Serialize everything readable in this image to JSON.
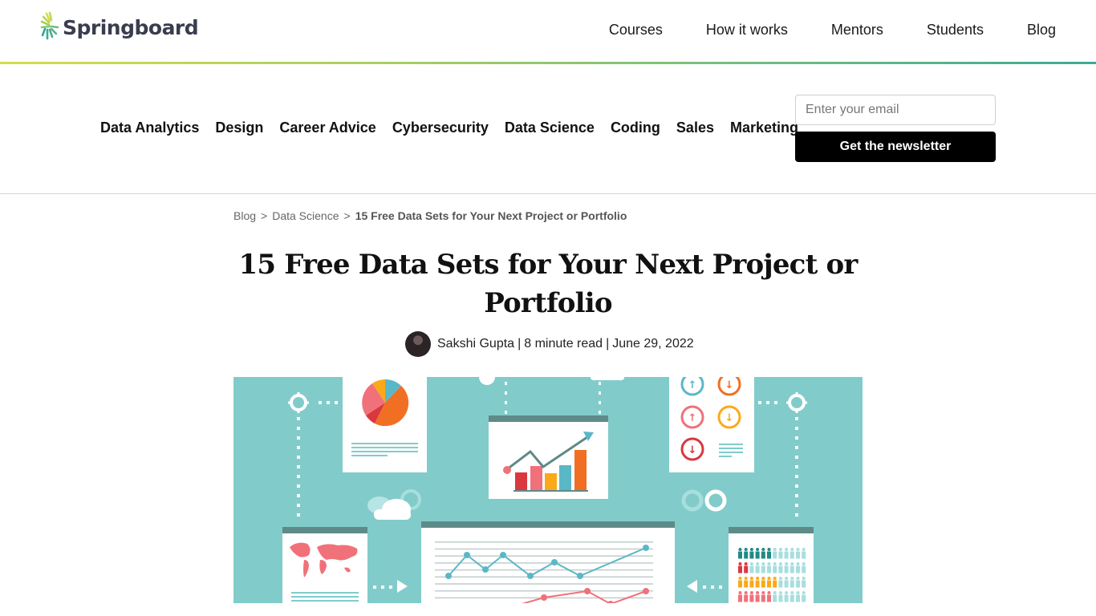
{
  "brand": {
    "name": "Springboard",
    "colors": {
      "text": "#3a3d4f",
      "accent_start": "#d3dd4a",
      "accent_end": "#3bab96"
    }
  },
  "topnav": {
    "items": [
      {
        "label": "Courses"
      },
      {
        "label": "How it works"
      },
      {
        "label": "Mentors"
      },
      {
        "label": "Students"
      },
      {
        "label": "Blog"
      }
    ]
  },
  "categories": {
    "items": [
      {
        "label": "Data Analytics"
      },
      {
        "label": "Design"
      },
      {
        "label": "Career Advice"
      },
      {
        "label": "Cybersecurity"
      },
      {
        "label": "Data Science"
      },
      {
        "label": "Coding"
      },
      {
        "label": "Sales"
      },
      {
        "label": "Marketing"
      }
    ]
  },
  "newsletter": {
    "email_placeholder": "Enter your email",
    "email_value": "",
    "button_label": "Get the newsletter"
  },
  "breadcrumb": {
    "items": [
      {
        "label": "Blog"
      },
      {
        "label": "Data Science"
      }
    ],
    "separator": ">",
    "current": "15 Free Data Sets for Your Next Project or Portfolio"
  },
  "article": {
    "title": "15 Free Data Sets for Your Next Project or Portfolio",
    "author": "Sakshi Gupta",
    "read_time": "8 minute read",
    "date": "June 29, 2022",
    "divider": "|"
  },
  "hero_image": {
    "description": "Data-visualization illustration: dashboards, pie chart, bar chart, line charts, world map, people-grid infographic",
    "background_color": "#82cbcb",
    "palette": [
      "#d9383f",
      "#f0717a",
      "#fba919",
      "#5ab8c6",
      "#f16f22",
      "#5e8a88"
    ]
  }
}
